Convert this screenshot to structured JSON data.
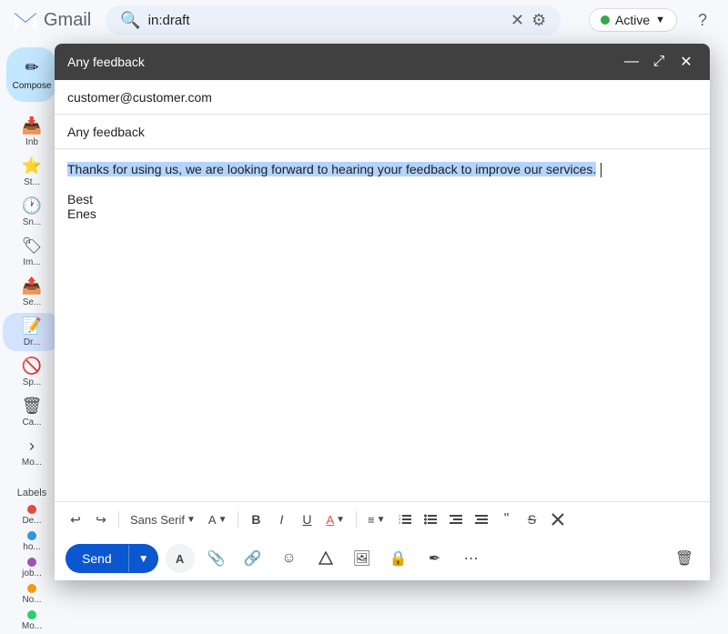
{
  "topbar": {
    "logo_text": "Gmail",
    "search_value": "in:draft",
    "active_label": "Active",
    "help_label": "?"
  },
  "sidebar": {
    "compose_label": "Compose",
    "items": [
      {
        "label": "Co...",
        "icon": "✉",
        "active": false
      },
      {
        "label": "Inb",
        "icon": "📥",
        "active": false
      },
      {
        "label": "St...",
        "icon": "⭐",
        "active": false
      },
      {
        "label": "Sn...",
        "icon": "🕐",
        "active": false
      },
      {
        "label": "Im...",
        "icon": "📧",
        "active": false
      },
      {
        "label": "Se...",
        "icon": "📤",
        "active": false
      },
      {
        "label": "Dr...",
        "icon": "📝",
        "active": true
      },
      {
        "label": "Sp...",
        "icon": "🚫",
        "active": false
      },
      {
        "label": "Ca...",
        "icon": "🗑",
        "active": false
      },
      {
        "label": "Mo...",
        "icon": "›",
        "active": false
      }
    ],
    "labels_title": "Labels",
    "labels": [
      {
        "label": "De...",
        "color": "#e74c3c"
      },
      {
        "label": "ho...",
        "color": "#3498db"
      },
      {
        "label": "job...",
        "color": "#9b59b6"
      },
      {
        "label": "No...",
        "color": "#f39c12"
      },
      {
        "label": "Mo...",
        "color": "#2ecc71"
      }
    ]
  },
  "compose": {
    "title": "Any feedback",
    "minimize_label": "—",
    "expand_label": "⤢",
    "close_label": "✕",
    "recipient": "customer@customer.com",
    "subject": "Any feedback",
    "body_highlighted": "Thanks for using us, we are looking forward to hearing your feedback to improve our services.",
    "body_line1": "Best",
    "body_line2": "Enes"
  },
  "toolbar": {
    "undo": "↩",
    "redo": "↪",
    "font_name": "Sans Serif",
    "font_size_icon": "A",
    "bold": "B",
    "italic": "I",
    "underline": "U",
    "text_color": "A",
    "align": "≡",
    "ordered_list": "≡",
    "unordered_list": "≡",
    "indent_less": "≡",
    "indent_more": "≡",
    "quote": "❝",
    "strikethrough": "S",
    "remove_format": "✕"
  },
  "actions": {
    "send_label": "Send",
    "formatting_label": "A",
    "attach_label": "📎",
    "link_label": "🔗",
    "emoji_label": "☺",
    "drive_label": "△",
    "photo_label": "🖼",
    "lock_label": "🔒",
    "signature_label": "✒",
    "more_label": "⋯",
    "delete_label": "🗑"
  }
}
